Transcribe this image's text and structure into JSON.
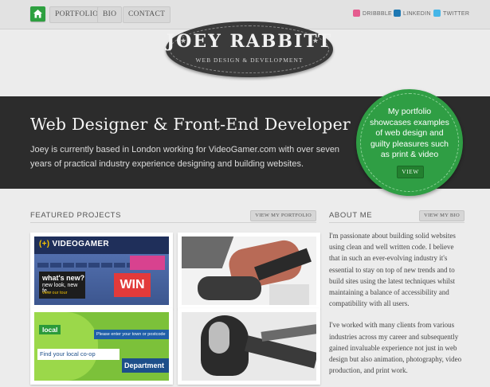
{
  "nav": {
    "items": [
      "PORTFOLIO",
      "BIO",
      "CONTACT"
    ]
  },
  "social": {
    "items": [
      "DRIBBBLE",
      "LINKEDIN",
      "TWITTER"
    ]
  },
  "logo": {
    "title": "JOEY RABBITT",
    "subtitle": "WEB DESIGN & DEVELOPMENT"
  },
  "hero": {
    "title": "Web Designer & Front-End Developer",
    "text": "Joey is currently based in London working for VideoGamer.com with over seven years of practical industry experience designing and building websites."
  },
  "bubble": {
    "text": "My portfolio showcases examples of web design and guilty pleasures such as print & video",
    "button": "VIEW"
  },
  "featured": {
    "title": "FEATURED PROJECTS",
    "button": "VIEW MY PORTFOLIO"
  },
  "about": {
    "title": "ABOUT ME",
    "button": "VIEW MY BIO",
    "paragraphs": [
      "I'm passionate about building solid websites using clean and well written code. I believe that in such an ever-evolving industry it's essential to stay on top of new trends and to build sites using the latest techniques whilst maintaining a balance of accessibility and compatibility with all users.",
      "I've worked with many clients from various industries across my career and subsequently gained invaluable experience not just in web design but also animation, photography, video production, and print work."
    ]
  },
  "thumbs": {
    "videogamer": {
      "logo_mark": "(+)",
      "logo": "VIDEOGAMER",
      "promo1": "what's new?",
      "promo2": "new look, new fe...",
      "promo3": "view our tour",
      "win": "WIN"
    },
    "local": {
      "label": "local",
      "search": "Please enter your town or postcode",
      "find": "Find your local co-op",
      "dept": "Department"
    }
  },
  "colors": {
    "accent_green": "#2ea040",
    "hero_bg": "#2c2c2c",
    "logo_bg": "#3a3a3a"
  }
}
